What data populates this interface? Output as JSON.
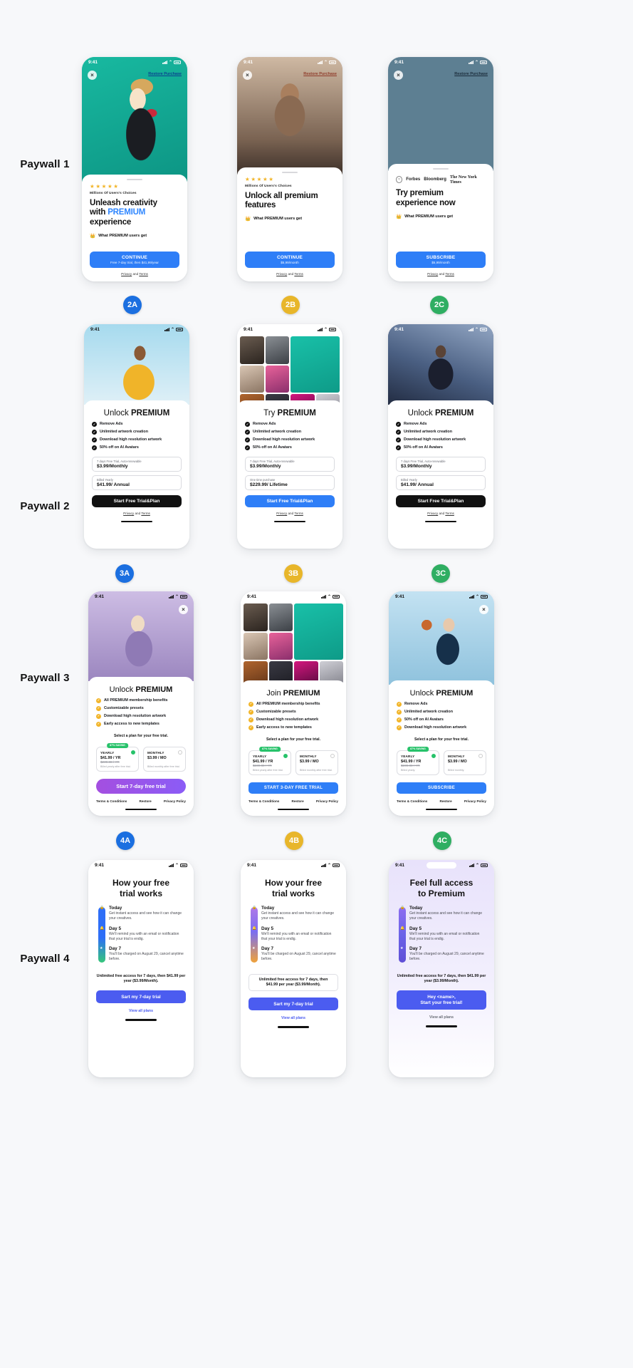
{
  "rows": [
    {
      "label": "Paywall 1"
    },
    {
      "label": "Paywall 2"
    },
    {
      "label": "Paywall 3"
    },
    {
      "label": "Paywall 4"
    }
  ],
  "badges": [
    {
      "id": "2A",
      "color": "#1b6fe0"
    },
    {
      "id": "2B",
      "color": "#e8b62a"
    },
    {
      "id": "2C",
      "color": "#2fae62"
    },
    {
      "id": "3A",
      "color": "#1b6fe0"
    },
    {
      "id": "3B",
      "color": "#e8b62a"
    },
    {
      "id": "3C",
      "color": "#2fae62"
    },
    {
      "id": "4A",
      "color": "#1b6fe0"
    },
    {
      "id": "4B",
      "color": "#e8b62a"
    },
    {
      "id": "4C",
      "color": "#2fae62"
    }
  ],
  "status": {
    "time": "9:41",
    "signal": "signal-icon",
    "wifi": "wifi-icon",
    "battery": "battery-icon"
  },
  "common": {
    "restore": "Restore Purchase",
    "close": "×",
    "privacy": "Privacy",
    "and": "and",
    "terms": "Terms",
    "social_proof": "Millions Of Users's Choices",
    "stars": "★★★★★",
    "crown": "What PREMIUM users get"
  },
  "p1a": {
    "title_line1": "Unleash creativity",
    "title_line2_pre": "with ",
    "title_line2_accent": "PREMIUM",
    "title_line3": "experience",
    "cta_main": "CONTINUE",
    "cta_sub": "Free 7-day trial, then $41,99/year"
  },
  "p1b": {
    "title_line1": "Unlock all premium",
    "title_line2": "features",
    "cta_main": "CONTINUE",
    "cta_sub": "$5,99/month"
  },
  "p1c": {
    "press": [
      "Forbes",
      "Bloomberg",
      "The New York Times"
    ],
    "title_line1": "Try premium",
    "title_line2": "experience now",
    "cta_main": "SUBSCRIBE",
    "cta_sub": "$5,99/month"
  },
  "p2a": {
    "title_pre": "Unlock ",
    "title_bold": "PREMIUM",
    "features": [
      "Remove Ads",
      "Unlimited artwork creation",
      "Download high resolution artwork",
      "50% off on AI Avatars"
    ],
    "opt1_top": "7 days Free Trial, Auto-renewable",
    "opt1_main": "$3.99/Monthly",
    "opt2_top": "Billed Yearly",
    "opt2_main": "$41.99/ Annual",
    "cta": "Start Free Trial&Plan"
  },
  "p2b": {
    "title_pre": "Try ",
    "title_bold": "PREMIUM",
    "features": [
      "Remove Ads",
      "Unlimited artwork creation",
      "Download high resolution artwork",
      "50% off on AI Avatars"
    ],
    "opt1_top": "7 days Free Trial, Auto-renewable",
    "opt1_main": "$3.99/Monthly",
    "opt2_top": "One time purchase",
    "opt2_main": "$229.99/ Lifetime",
    "cta": "Start Free Trial&Plan"
  },
  "p2c": {
    "title_pre": "Unlock ",
    "title_bold": "PREMIUM",
    "features": [
      "Remove Ads",
      "Unlimited artwork creation",
      "Download high resolution artwork",
      "50% off on AI Avatars"
    ],
    "opt1_top": "7 days Free Trial, Auto-renewable",
    "opt1_main": "$3.99/Monthly",
    "opt2_top": "Billed Yearly",
    "opt2_main": "$41.99/ Annual",
    "cta": "Start Free Trial&Plan"
  },
  "p3a": {
    "title_pre": "Unlock ",
    "title_bold": "PREMIUM",
    "features": [
      "All PREMIUM membership benefits",
      "Customizable presets",
      "Download high resolution artwork",
      "Early access to new templates"
    ],
    "select_note": "Select a plan for your free trial.",
    "save_tag": "87% SAVING",
    "plan1_name": "YEARLY",
    "plan1_price": "$41.99 / YR",
    "plan1_old": "$239.88 / YR",
    "plan1_note": "Billed yearly after free trial.",
    "plan2_name": "MONTHLY",
    "plan2_price": "$3.99 / MO",
    "plan2_note": "Billed monthly after free trial.",
    "cta": "Start 7-day free trial",
    "links": [
      "Terms & Conditions",
      "Restore",
      "Privacy Policy"
    ]
  },
  "p3b": {
    "title_pre": "Join ",
    "title_bold": "PREMIUM",
    "features": [
      "All PREMIUM membership benefits",
      "Customizable presets",
      "Download high resolution artwork",
      "Early access to new templates"
    ],
    "select_note": "Select a plan for your free trial.",
    "save_tag": "87% SAVING",
    "plan1_name": "YEARLY",
    "plan1_price": "$41.99 / YR",
    "plan1_old": "$239.88 / YR",
    "plan1_note": "Billed yearly after free trial.",
    "plan2_name": "MONTHLY",
    "plan2_price": "$3.99 / MO",
    "plan2_note": "Billed monthly after free trial.",
    "cta": "START 3-DAY FREE TRIAL",
    "links": [
      "Terms & Conditions",
      "Restore",
      "Privacy Policy"
    ]
  },
  "p3c": {
    "title_pre": "Unlock ",
    "title_bold": "PREMIUM",
    "features": [
      "Remove Ads",
      "Unlimited artwork creation",
      "50% off on AI Avatars",
      "Download high resolution artwork"
    ],
    "select_note": "Select a plan for your free trial.",
    "save_tag": "87% SAVING",
    "plan1_name": "YEARLY",
    "plan1_price": "$41.99 / YR",
    "plan1_old": "$239.88 / YR",
    "plan1_note": "Billed yearly.",
    "plan2_name": "MONTHLY",
    "plan2_price": "$3.99 / MO",
    "plan2_note": "Billed monthly.",
    "cta": "SUBSCRIBE",
    "links": [
      "Terms & Conditions",
      "Restore",
      "Privacy Policy"
    ]
  },
  "p4a": {
    "title_line1": "How your free",
    "title_line2": "trial works",
    "steps": [
      {
        "icon": "lock-icon",
        "head": "Today",
        "body": "Get instant access and see how it can change your creatives."
      },
      {
        "icon": "bell-icon",
        "head": "Day 5",
        "body": "We'll remind you with an email or notification that your trial is endig."
      },
      {
        "icon": "star-icon",
        "head": "Day 7",
        "body": "You'll be charged on August 29, cancel anytime before."
      }
    ],
    "note": "Unlimited free access for 7 days, then $41.99 per year ($3.99/Month).",
    "cta": "Sart my 7-day trial",
    "viewall": "View all plans"
  },
  "p4b": {
    "title_line1": "How your free",
    "title_line2": "trial works",
    "steps": [
      {
        "icon": "lock-icon",
        "head": "Today",
        "body": "Get instant access and see how it can change your creatives."
      },
      {
        "icon": "bell-icon",
        "head": "Day 5",
        "body": "We'll remind you with an email or notification that your trial is endig."
      },
      {
        "icon": "star-icon",
        "head": "Day 7",
        "body": "You'll be charged on August 29, cancel anytime before."
      }
    ],
    "note": "Unlimited free access for 7 days, then $41.99 per year ($3.99/Month).",
    "cta": "Sart my 7-day trial",
    "viewall": "View all plans"
  },
  "p4c": {
    "title_line1": "Feel full access",
    "title_line2": "to Premium",
    "steps": [
      {
        "icon": "lock-icon",
        "head": "Today",
        "body": "Get instant access and see how it can change your creatives."
      },
      {
        "icon": "bell-icon",
        "head": "Day 5",
        "body": "We'll remind you with an email or notification that your trial is endig."
      },
      {
        "icon": "star-icon",
        "head": "Day 7",
        "body": "You'll be charged on August 29, cancel anytime before."
      }
    ],
    "note": "Unlimited free access for 7 days, then $41.99 per year ($3.99/Month).",
    "cta_line1": "Hey <name>,",
    "cta_line2": "Start your free trial!",
    "viewall": "View all plans"
  }
}
